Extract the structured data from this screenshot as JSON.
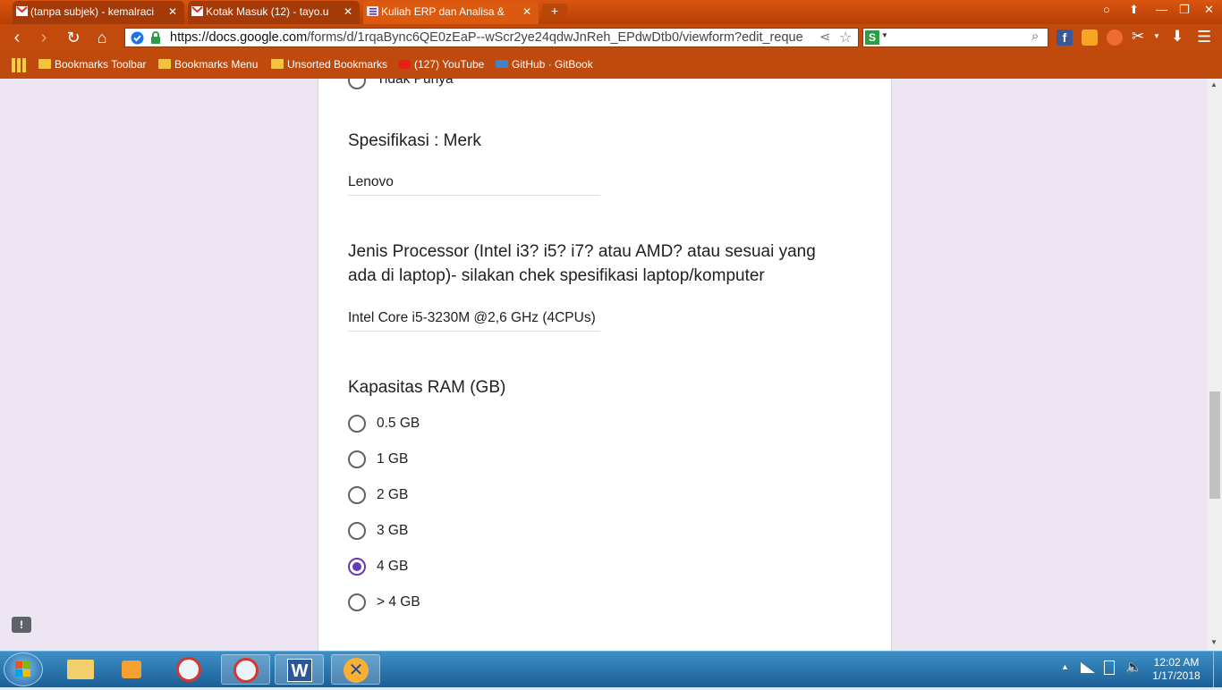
{
  "browser": {
    "tabs": [
      {
        "title": "(tanpa subjek) - kemalraci",
        "icon": "gmail-icon"
      },
      {
        "title": "Kotak Masuk (12) - tayo.u",
        "icon": "gmail-icon"
      },
      {
        "title": "Kuliah ERP dan Analisa &",
        "icon": "google-forms-icon"
      }
    ],
    "new_tab_label": "+",
    "url_domain": "https://docs.google.com",
    "url_path": "/forms/d/1rqaBync6QE0zEaP--wScr2ye24qdwJnReh_EPdwDtb0/viewform?edit_reque",
    "search_engine_label": "S",
    "bookmarks": [
      {
        "label": "Bookmarks Toolbar",
        "icon": "folder-icon"
      },
      {
        "label": "Bookmarks Menu",
        "icon": "folder-icon"
      },
      {
        "label": "Unsorted Bookmarks",
        "icon": "folder-icon"
      },
      {
        "label": "(127) YouTube",
        "icon": "youtube-icon"
      },
      {
        "label": "GitHub · GitBook",
        "icon": "gitbook-icon"
      }
    ],
    "accent_color": "#c84608"
  },
  "form": {
    "partial_option": "Tidak Punya",
    "q_merk": {
      "title": "Spesifikasi : Merk",
      "answer": "Lenovo"
    },
    "q_processor": {
      "title_line1": "Jenis Processor (Intel i3? i5? i7? atau AMD? atau sesuai yang",
      "title_line2": "ada di laptop)- silakan chek spesifikasi laptop/komputer",
      "answer": "Intel Core i5-3230M @2,6 GHz (4CPUs)"
    },
    "q_ram": {
      "title": "Kapasitas RAM (GB)",
      "options": [
        "0.5 GB",
        "1 GB",
        "2 GB",
        "3 GB",
        "4 GB",
        "> 4 GB"
      ],
      "selected": "4 GB"
    },
    "accent_color": "#673ab7"
  },
  "taskbar": {
    "apps": [
      "windows-explorer-icon",
      "media-player-icon",
      "browser-icon",
      "browser-icon",
      "word-icon",
      "xampp-icon"
    ],
    "time": "12:02 AM",
    "date": "1/17/2018"
  }
}
